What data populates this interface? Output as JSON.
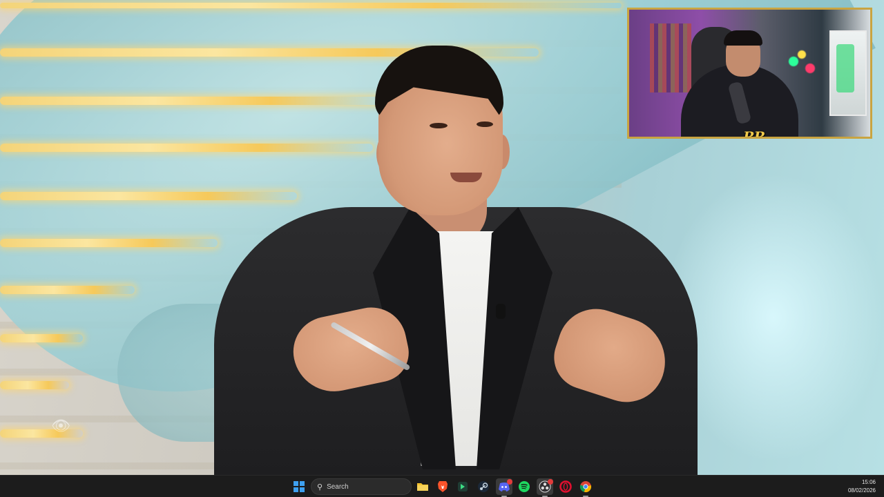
{
  "video": {
    "watermark_icon": "eye-icon"
  },
  "webcam": {
    "logo_text": "RR"
  },
  "taskbar": {
    "start_icon": "windows-start-icon",
    "search_placeholder": "Search",
    "pinned_apps": [
      {
        "name": "file-explorer",
        "icon": "folder-icon"
      },
      {
        "name": "brave-browser",
        "icon": "brave-lion-icon"
      },
      {
        "name": "app-green-tool",
        "icon": "green-arrow-icon"
      },
      {
        "name": "steam",
        "icon": "steam-icon"
      },
      {
        "name": "discord",
        "icon": "discord-icon"
      },
      {
        "name": "spotify",
        "icon": "spotify-icon"
      },
      {
        "name": "obs-studio",
        "icon": "obs-icon"
      },
      {
        "name": "opera-gx",
        "icon": "opera-icon"
      },
      {
        "name": "chrome",
        "icon": "chrome-icon"
      }
    ],
    "clock": {
      "time": "15:06",
      "date": "08/02/2026"
    }
  }
}
